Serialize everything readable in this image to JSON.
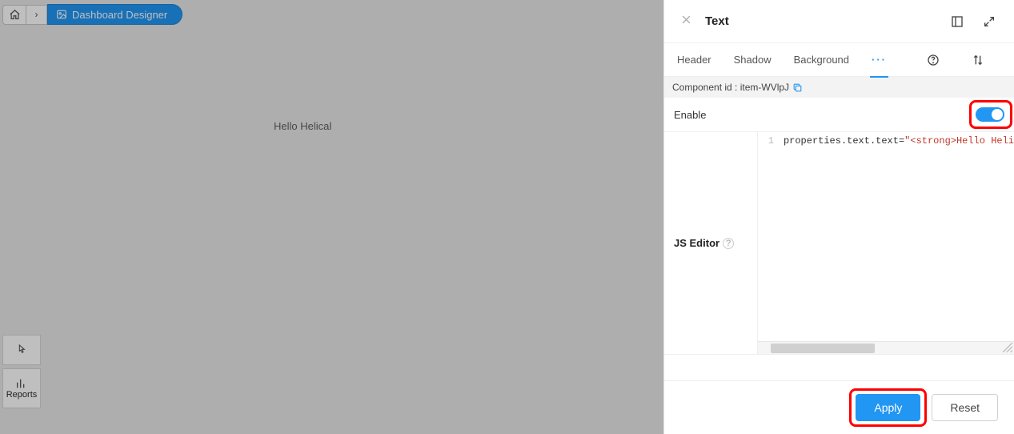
{
  "breadcrumb": {
    "active_label": "Dashboard Designer"
  },
  "canvas": {
    "text": "Hello Helical"
  },
  "lefttoolbar": {
    "reports_label": "Reports"
  },
  "panel": {
    "title": "Text",
    "tabs": {
      "header": "Header",
      "shadow": "Shadow",
      "background": "Background",
      "more": "···"
    },
    "component_id_label": "Component id : item-WVlpJ",
    "enable_label": "Enable",
    "enable_value": true,
    "js_editor_label": "JS Editor",
    "code": {
      "line_no": "1",
      "prefix": "properties.text.text=",
      "string_part": "\"<strong>Hello Heli"
    },
    "footer": {
      "apply": "Apply",
      "reset": "Reset"
    }
  }
}
